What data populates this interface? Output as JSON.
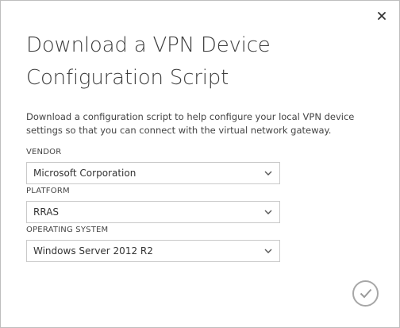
{
  "dialog": {
    "title": "Download a VPN Device Configuration Script",
    "description": "Download a configuration script to help configure your local VPN device settings so that you can connect with the virtual network gateway."
  },
  "fields": {
    "vendor": {
      "label": "VENDOR",
      "value": "Microsoft Corporation"
    },
    "platform": {
      "label": "PLATFORM",
      "value": "RRAS"
    },
    "os": {
      "label": "OPERATING SYSTEM",
      "value": "Windows Server 2012 R2"
    }
  },
  "icons": {
    "close": "close-icon",
    "chevron": "chevron-down-icon",
    "confirm": "checkmark-icon"
  },
  "colors": {
    "text": "#3d3d3d",
    "border": "#c9c9c9",
    "confirm": "#a7a7a7"
  }
}
